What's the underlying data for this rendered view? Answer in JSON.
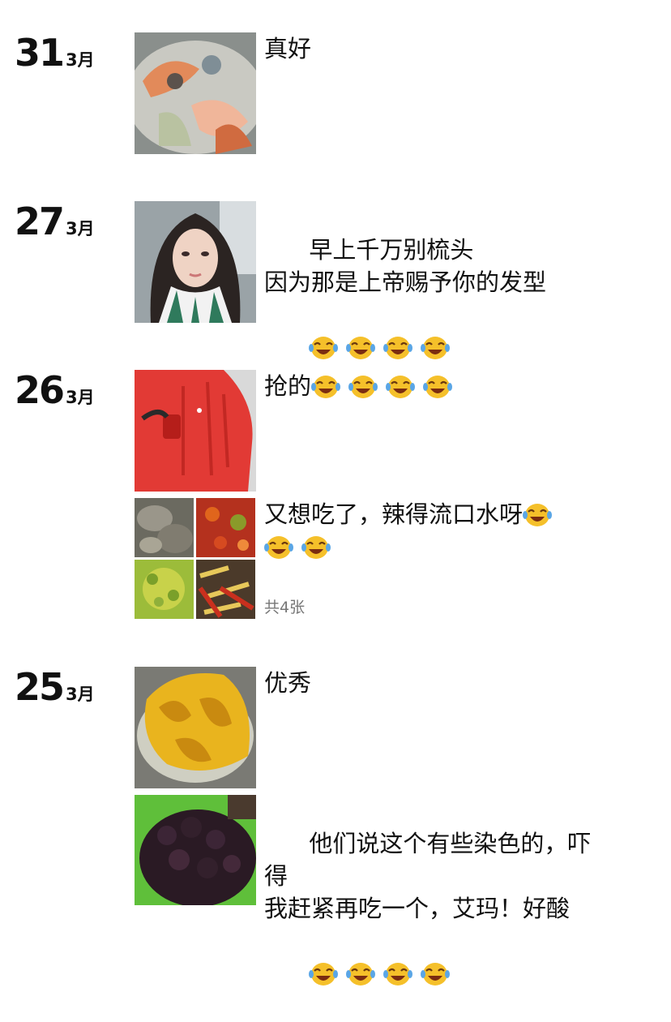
{
  "timeline": [
    {
      "day": "31",
      "month": "3月",
      "posts": [
        {
          "text": "真好",
          "emoji_count": 0,
          "image": "seafood-bowl"
        }
      ]
    },
    {
      "day": "27",
      "month": "3月",
      "posts": [
        {
          "text": "早上千万别梳头\n因为那是上帝赐予你的发型",
          "emoji_count": 4,
          "image": "selfie-portrait"
        }
      ]
    },
    {
      "day": "26",
      "month": "3月",
      "posts": [
        {
          "text": "抢的",
          "emoji_count": 4,
          "image": "red-mat"
        },
        {
          "text": "又想吃了，辣得流口水呀",
          "emoji_count": 3,
          "image_grid": [
            "oysters",
            "chili-stew",
            "green-peas",
            "pepper-mix"
          ],
          "photo_count": "共4张"
        }
      ]
    },
    {
      "day": "25",
      "month": "3月",
      "posts": [
        {
          "text": "优秀",
          "emoji_count": 0,
          "image": "yellow-fruit-bowl"
        },
        {
          "text": "他们说这个有些染色的，吓得\n我赶紧再吃一个，艾玛！好酸",
          "emoji_count": 4,
          "image": "mulberries"
        }
      ]
    }
  ],
  "emoji_name": "tears-of-joy-icon",
  "colors": {
    "text": "#111111",
    "muted": "#777777",
    "background": "#ffffff",
    "emoji": "#f5c02a"
  }
}
